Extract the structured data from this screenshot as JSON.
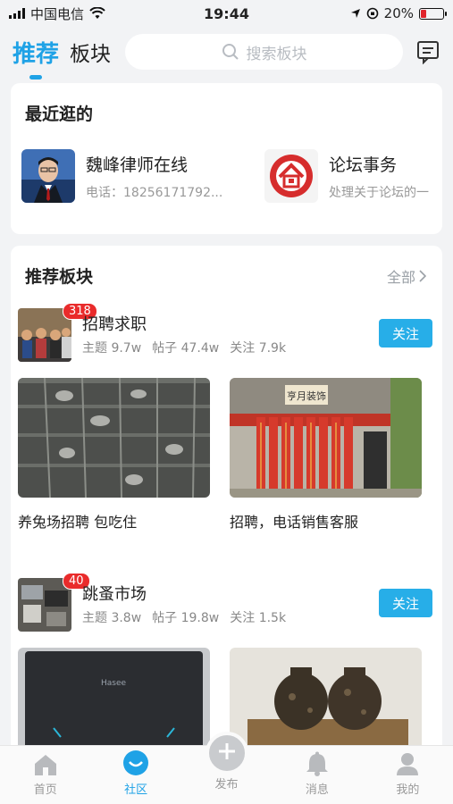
{
  "status_bar": {
    "carrier": "中国电信",
    "time": "19:44",
    "battery": "20%"
  },
  "header": {
    "tab_active": "推荐",
    "tab_other": "板块",
    "search_placeholder": "搜索板块"
  },
  "recent": {
    "title": "最近逛的",
    "items": [
      {
        "name": "魏峰律师在线",
        "desc": "电话：18256171792..."
      },
      {
        "name": "论坛事务",
        "desc": "处理关于论坛的一"
      }
    ]
  },
  "recommend": {
    "title": "推荐板块",
    "more_label": "全部",
    "boards": [
      {
        "name": "招聘求职",
        "badge": "318",
        "stats": {
          "topics": "主题 9.7w",
          "posts": "帖子 47.4w",
          "follows": "关注 7.9k"
        },
        "follow_label": "关注",
        "posts_list": [
          {
            "caption": "养兔场招聘 包吃住"
          },
          {
            "caption": "招聘，电话销售客服"
          }
        ],
        "storefront_sign": "亨月装饰"
      },
      {
        "name": "跳蚤市场",
        "badge": "40",
        "stats": {
          "topics": "主题 3.8w",
          "posts": "帖子 19.8w",
          "follows": "关注 1.5k"
        },
        "follow_label": "关注",
        "posts_list": [
          {
            "caption": ""
          },
          {
            "caption": ""
          }
        ],
        "laptop_brand": "Hasee"
      }
    ]
  },
  "bottom_nav": [
    {
      "label": "首页",
      "icon": "home-icon",
      "active": false
    },
    {
      "label": "社区",
      "icon": "community-icon",
      "active": true
    },
    {
      "label": "发布",
      "icon": "plus-icon",
      "active": false
    },
    {
      "label": "消息",
      "icon": "bell-icon",
      "active": false
    },
    {
      "label": "我的",
      "icon": "user-icon",
      "active": false
    }
  ],
  "colors": {
    "accent": "#1fa2e6",
    "follow_button": "#27aee8",
    "badge": "#e92b2b"
  }
}
